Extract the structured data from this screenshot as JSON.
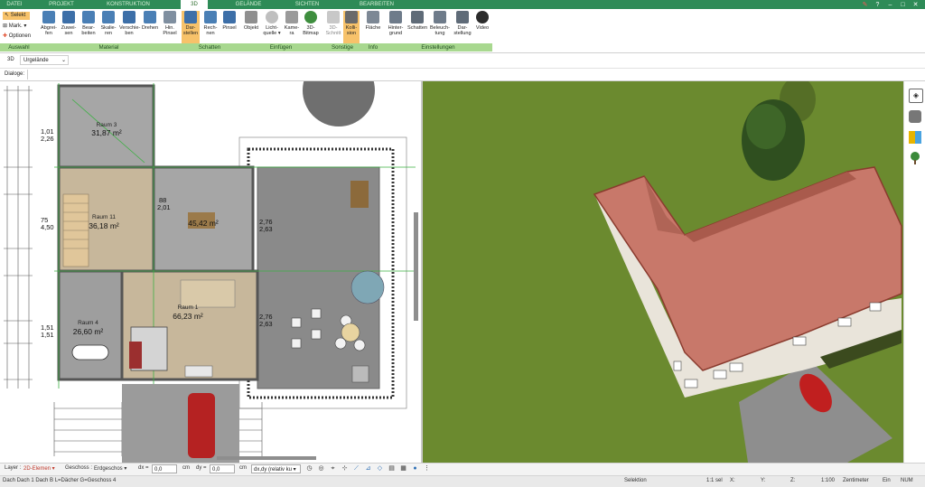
{
  "tabs": [
    "DATEI",
    "PROJEKT",
    "KONSTRUKTION",
    "3D",
    "GELÄNDE",
    "SICHTEN",
    "BEARBEITEN"
  ],
  "active_tab": "3D",
  "ribbon": {
    "left_tools": {
      "select": "Selekt",
      "mark": "Mark.",
      "options": "Optionen"
    },
    "buttons": [
      {
        "id": "abgreifen",
        "l1": "Abgrei-",
        "l2": "fen"
      },
      {
        "id": "zuweisen",
        "l1": "Zuwei-",
        "l2": "sen"
      },
      {
        "id": "bearbeiten",
        "l1": "Bear-",
        "l2": "beiten"
      },
      {
        "id": "skalieren",
        "l1": "Skalie-",
        "l2": "ren"
      },
      {
        "id": "verschieben",
        "l1": "Verschie-",
        "l2": "ben"
      },
      {
        "id": "drehen",
        "l1": "Drehen",
        "l2": ""
      },
      {
        "id": "hinpinsel",
        "l1": "Hin.",
        "l2": "Pinsel"
      },
      {
        "id": "darstellen",
        "l1": "Dar-",
        "l2": "stellen"
      },
      {
        "id": "rechnen",
        "l1": "Rech-",
        "l2": "nen"
      },
      {
        "id": "pinsel",
        "l1": "Pinsel",
        "l2": ""
      },
      {
        "id": "objekt",
        "l1": "Objekt",
        "l2": ""
      },
      {
        "id": "lichtquelle",
        "l1": "Licht-",
        "l2": "quelle ▾"
      },
      {
        "id": "kamera",
        "l1": "Kame-",
        "l2": "ra"
      },
      {
        "id": "bitmap",
        "l1": "3D-",
        "l2": "Bitmap"
      },
      {
        "id": "schnitt",
        "l1": "3D-",
        "l2": "Schnitt"
      },
      {
        "id": "kollision",
        "l1": "Kolli-",
        "l2": "sion"
      },
      {
        "id": "flaeche",
        "l1": "Fläche",
        "l2": ""
      },
      {
        "id": "hintergrund",
        "l1": "Hinter-",
        "l2": "grund"
      },
      {
        "id": "schatten",
        "l1": "Schatten",
        "l2": ""
      },
      {
        "id": "beleuchtung",
        "l1": "Beleuch-",
        "l2": "tung"
      },
      {
        "id": "darstellung",
        "l1": "Dar-",
        "l2": "stellung"
      },
      {
        "id": "video",
        "l1": "Video",
        "l2": ""
      }
    ],
    "groups": [
      "Auswahl",
      "Material",
      "Schatten",
      "Einfügen",
      "Sonstige",
      "Info",
      "Einstellungen"
    ]
  },
  "row2": {
    "mode": "3D",
    "layer": "Urgelände"
  },
  "row3": {
    "label": "Dialoge:"
  },
  "plan": {
    "rooms": [
      {
        "name": "Raum 3",
        "area": "31,87 m²"
      },
      {
        "name": "Raum 11",
        "area": "36,18 m²"
      },
      {
        "name": "Raum 4",
        "area": "26,60 m²"
      },
      {
        "name": "Raum 1",
        "area": "66,23 m²"
      },
      {
        "name": "",
        "area": "45,42 m²"
      }
    ],
    "dims": {
      "d1a": "1,01",
      "d1b": "2,26",
      "d2a": "75",
      "d2b": "4,50",
      "d3a": "1,51",
      "d3b": "1,51",
      "d4a": "88",
      "d4b": "2,01",
      "d5a": "2,76",
      "d5b": "2,63",
      "d6a": "2,76",
      "d6b": "2,63"
    }
  },
  "status1": {
    "layer_label": "Layer :",
    "layer_value": "2D-Elemen ▾",
    "geschoss_label": "Geschoss :",
    "geschoss_value": "Erdgeschos ▾",
    "dx_label": "dx =",
    "dx_value": "0,0",
    "dx_unit": "cm",
    "dy_label": "dy =",
    "dy_value": "0,0",
    "dy_unit": "cm",
    "mode_value": "dx,dy (relativ ku ▾"
  },
  "status2": {
    "info": "Dach Dach 1 Dach B L=Dächer G=Geschoss 4",
    "selektion": "Selektion",
    "sel_count": "1:1 sel",
    "x": "X:",
    "y": "Y:",
    "z": "Z:",
    "scale": "1:100",
    "unit": "Zentimeter",
    "ein": "Ein",
    "num": "NUM"
  },
  "colors": {
    "tabbar": "#2e8b57",
    "group": "#a8d88f",
    "highlight": "#f7c26a",
    "grass": "#6b8a2f",
    "roof": "#c8786a"
  }
}
